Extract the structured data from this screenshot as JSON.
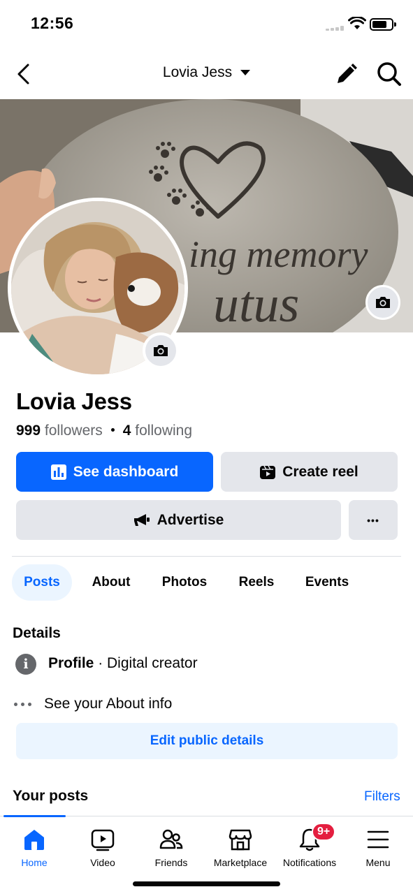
{
  "status_bar": {
    "time": "12:56"
  },
  "top_nav": {
    "title": "Lovia Jess"
  },
  "cover": {
    "photo_text_line1": "ing memory",
    "photo_text_line2": "utus",
    "stone_color": "#a9a49b",
    "engraving_color": "#3a3530"
  },
  "profile": {
    "name": "Lovia Jess",
    "followers_count": "999",
    "followers_label": "followers",
    "following_count": "4",
    "following_label": "following"
  },
  "actions": {
    "dashboard_label": "See dashboard",
    "reel_label": "Create reel",
    "advertise_label": "Advertise",
    "more_label": "•••"
  },
  "tabs": [
    {
      "label": "Posts",
      "active": true
    },
    {
      "label": "About",
      "active": false
    },
    {
      "label": "Photos",
      "active": false
    },
    {
      "label": "Reels",
      "active": false
    },
    {
      "label": "Events",
      "active": false
    }
  ],
  "details": {
    "title": "Details",
    "profile_key": "Profile",
    "profile_value": " · Digital creator",
    "about_link": "See your About info",
    "edit_button": "Edit public details"
  },
  "posts_section": {
    "title": "Your posts",
    "filters": "Filters"
  },
  "bottom_nav": {
    "items": [
      {
        "label": "Home",
        "icon": "home-icon",
        "active": true
      },
      {
        "label": "Video",
        "icon": "video-icon",
        "active": false
      },
      {
        "label": "Friends",
        "icon": "friends-icon",
        "active": false
      },
      {
        "label": "Marketplace",
        "icon": "marketplace-icon",
        "active": false
      },
      {
        "label": "Notifications",
        "icon": "bell-icon",
        "active": false,
        "badge": "9+"
      },
      {
        "label": "Menu",
        "icon": "menu-icon",
        "active": false
      }
    ]
  },
  "colors": {
    "accent": "#0866ff",
    "button_gray": "#e4e6eb",
    "badge_red": "#e41e3f",
    "secondary_text": "#65676b"
  }
}
